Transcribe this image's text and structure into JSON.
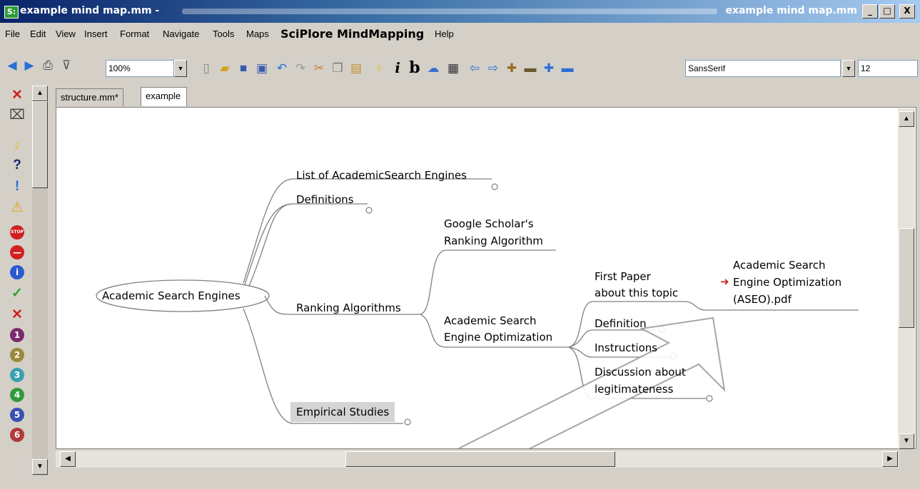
{
  "window": {
    "app_icon": "S:",
    "title_left": "example mind map.mm -",
    "title_right": "example mind map.mm",
    "min": "_",
    "max": "□",
    "close": "X"
  },
  "menu": {
    "file": "File",
    "edit": "Edit",
    "view": "View",
    "insert": "Insert",
    "format": "Format",
    "navigate": "Navigate",
    "tools": "Tools",
    "maps": "Maps",
    "brand": "SciPlore MindMapping",
    "help": "Help"
  },
  "toolbar": {
    "zoom": "100%",
    "font": "SansSerif",
    "size": "12",
    "italic_label": "i",
    "bold_label": "b"
  },
  "tabs": [
    "structure.mm*",
    "example mind map.mm"
  ],
  "mindmap": {
    "root": "Academic Search Engines",
    "list": "List of AcademicSearch Engines",
    "definitions": "Definitions",
    "google_1": "Google Scholar's",
    "google_2": "Ranking Algorithm",
    "ranking": "Ranking Algorithms",
    "aseo_1": "Academic Search",
    "aseo_2": "Engine Optimization",
    "first_1": "First Paper",
    "first_2": "about this topic",
    "pdf_1": "Academic Search",
    "pdf_2": "Engine Optimization",
    "pdf_3": "(ASEO).pdf",
    "definition": "Definition",
    "instructions": "Instructions",
    "discussion_1": "Discussion about",
    "discussion_2": "legitimateness",
    "empirical": "Empirical Studies"
  },
  "icons": {
    "numbers": [
      "1",
      "2",
      "3",
      "4",
      "5",
      "6"
    ],
    "number_colors": [
      "#7a2a6e",
      "#9a8a3a",
      "#3aa0b0",
      "#2f9a3a",
      "#3a50b0",
      "#b03a3a"
    ]
  }
}
